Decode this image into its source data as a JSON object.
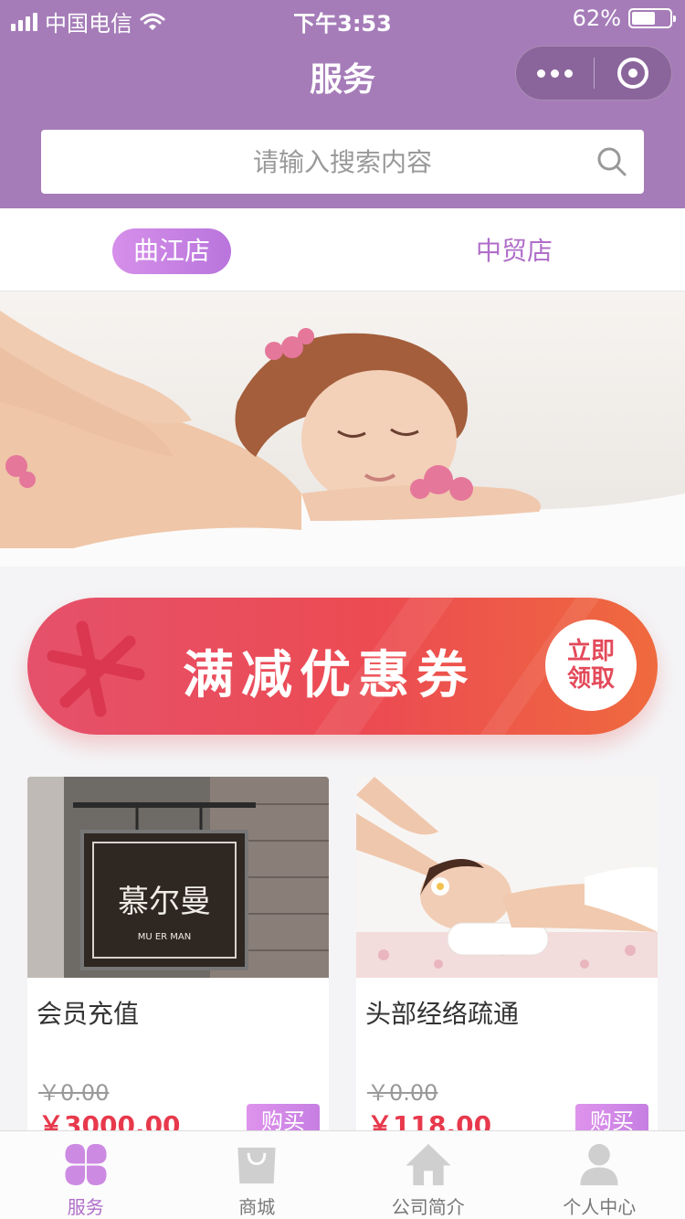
{
  "status_bar": {
    "carrier": "中国电信",
    "time": "下午3:53",
    "battery_text": "62%",
    "battery_level": 0.62
  },
  "nav": {
    "title": "服务"
  },
  "search": {
    "placeholder": "请输入搜索内容"
  },
  "stores": {
    "tabs": [
      {
        "label": "曲江店",
        "active": true
      },
      {
        "label": "中贸店",
        "active": false
      }
    ]
  },
  "coupon": {
    "title": "满减优惠券",
    "claim_line1": "立即",
    "claim_line2": "领取"
  },
  "products": [
    {
      "name": "会员充值",
      "original_price": "￥0.00",
      "price": "￥3000.00",
      "buy_label": "购买",
      "sign_text": "慕尔曼",
      "sign_subtext": "MU ER MAN"
    },
    {
      "name": "头部经络疏通",
      "original_price": "￥0.00",
      "price": "￥118.00",
      "buy_label": "购买"
    }
  ],
  "tab_bar": {
    "items": [
      {
        "label": "服务",
        "icon": "grid-petals-icon",
        "active": true
      },
      {
        "label": "商城",
        "icon": "shopping-bag-icon",
        "active": false
      },
      {
        "label": "公司简介",
        "icon": "home-icon",
        "active": false
      },
      {
        "label": "个人中心",
        "icon": "person-icon",
        "active": false
      }
    ]
  },
  "colors": {
    "header": "#a57cb8",
    "accent": "#b06ec9",
    "price": "#e8394c",
    "coupon_start": "#e5516b",
    "coupon_end": "#ef6a3e"
  }
}
